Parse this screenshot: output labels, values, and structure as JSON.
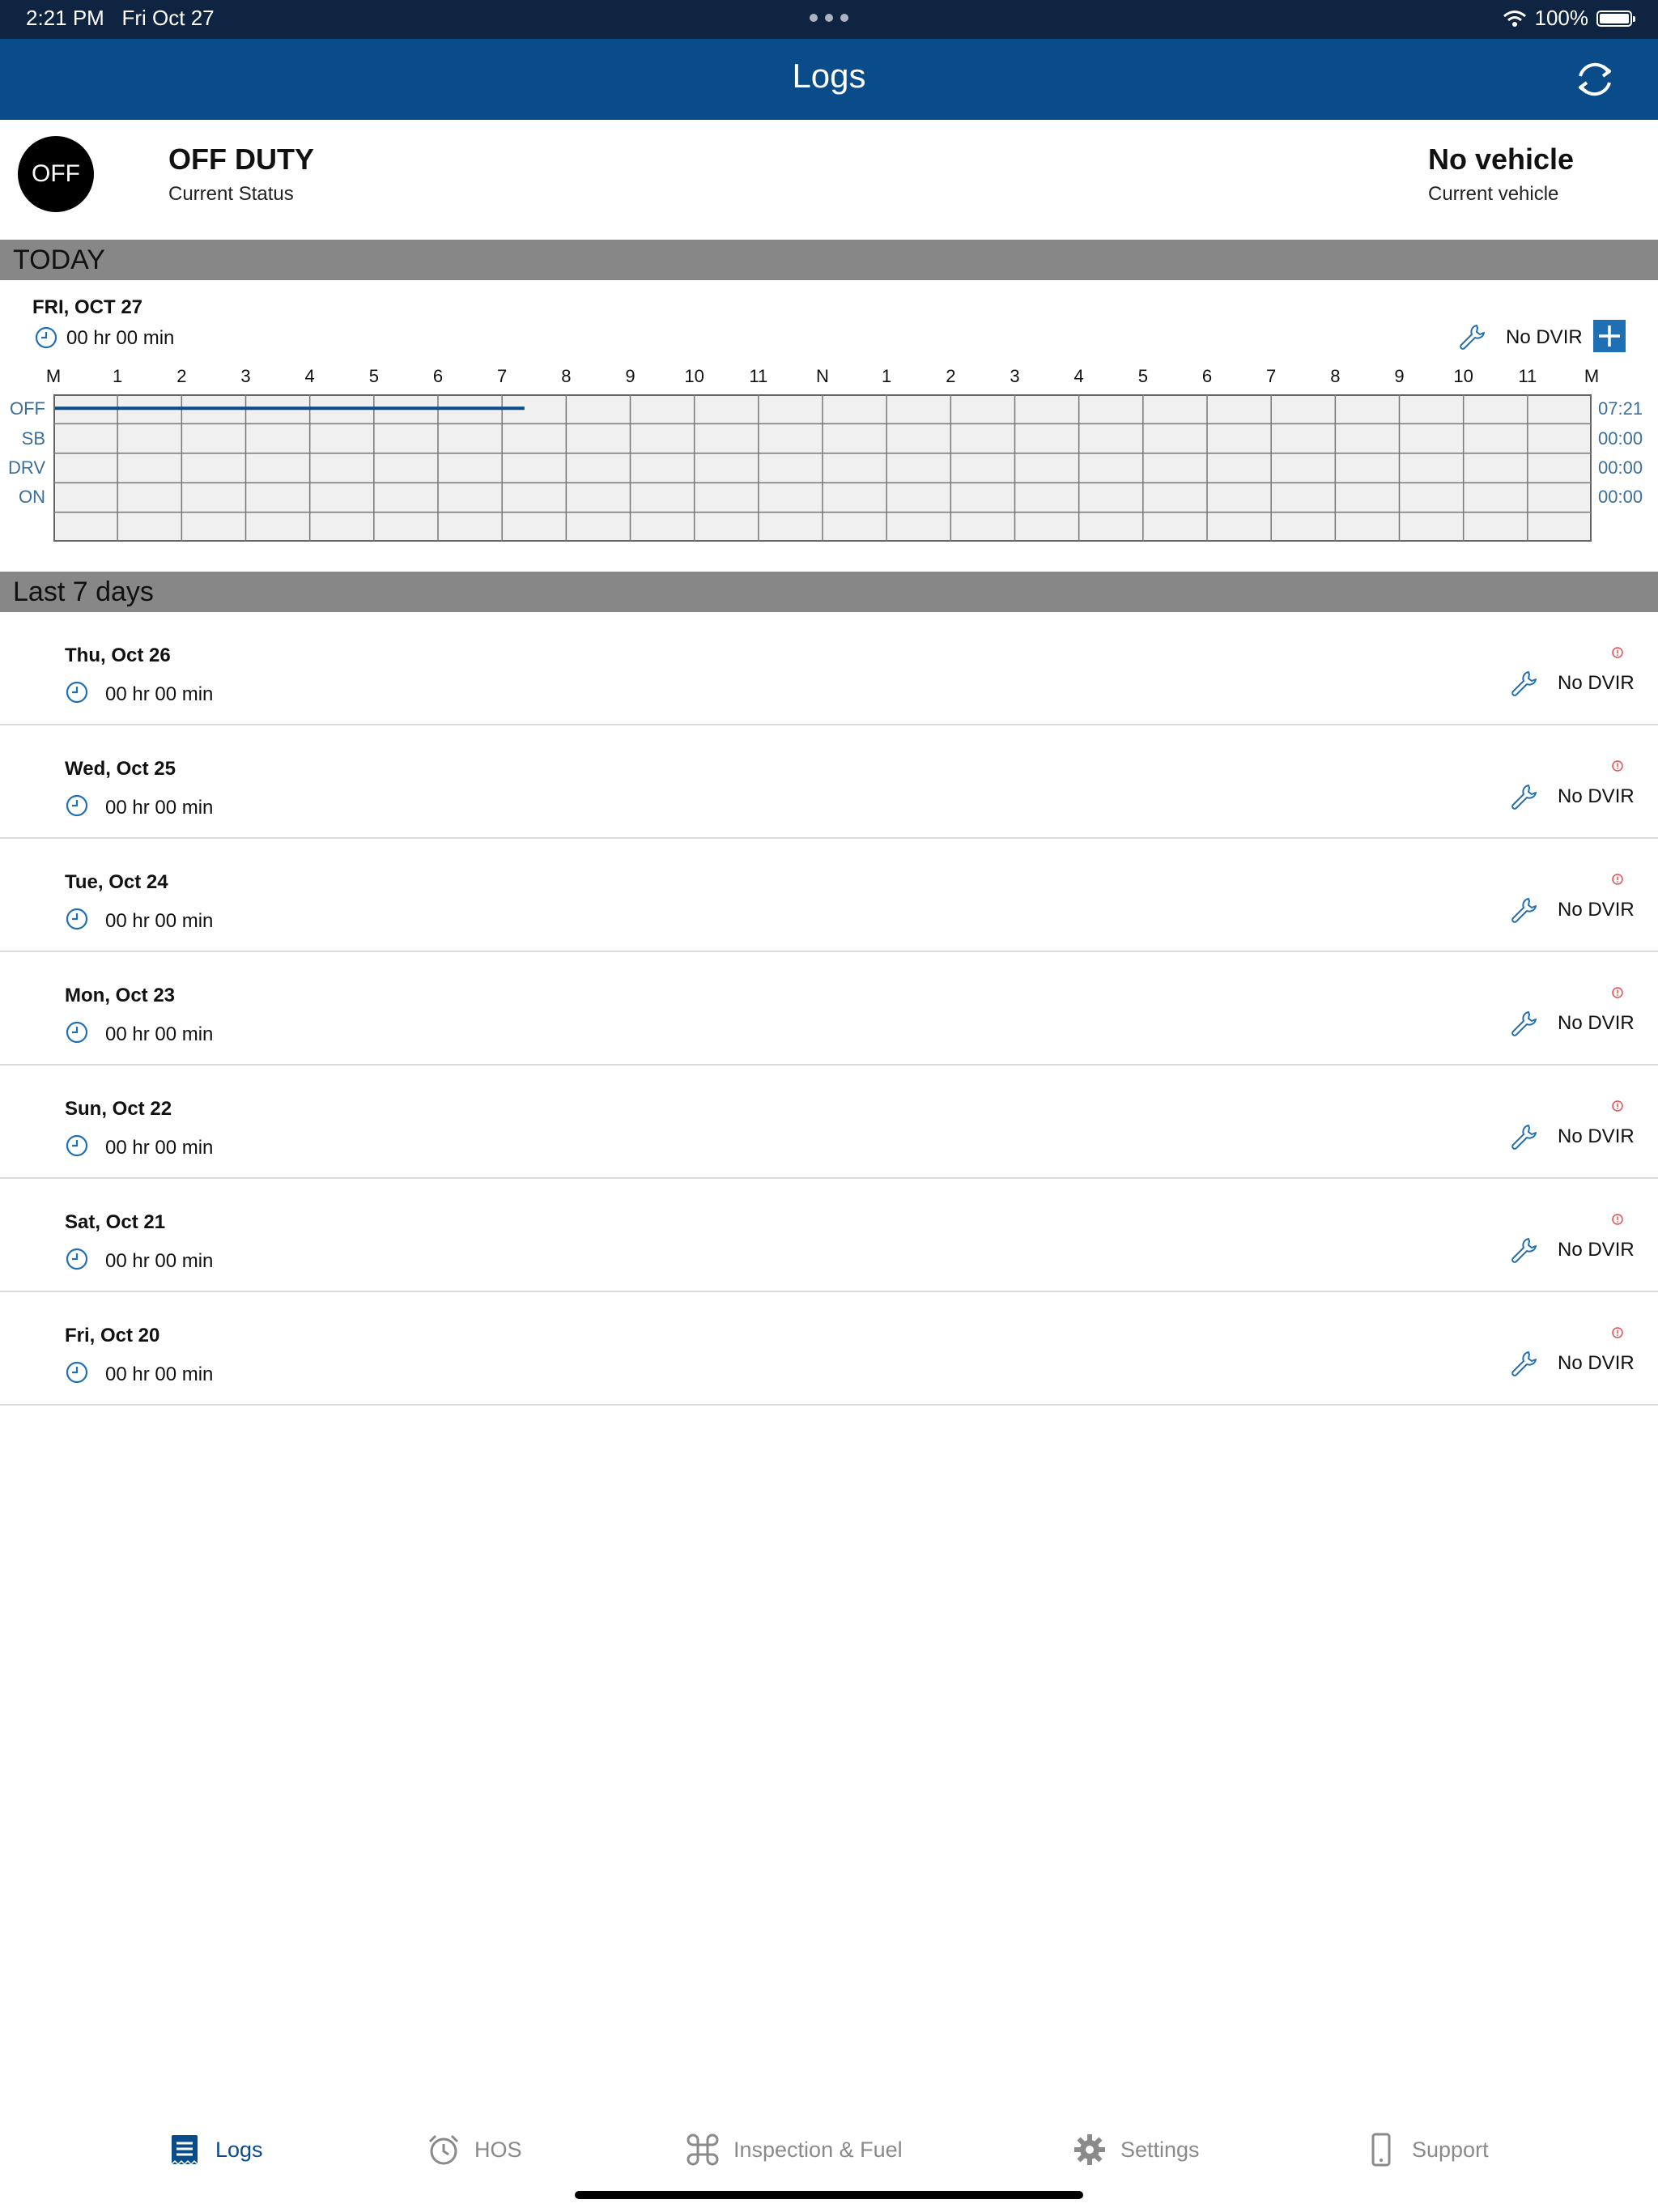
{
  "status_bar": {
    "time": "2:21 PM",
    "date": "Fri Oct 27",
    "battery": "100%"
  },
  "nav": {
    "title": "Logs"
  },
  "current": {
    "badge": "OFF",
    "status": "OFF DUTY",
    "status_label": "Current Status",
    "vehicle": "No vehicle",
    "vehicle_label": "Current vehicle"
  },
  "today": {
    "section_title": "TODAY",
    "date": "FRI, OCT 27",
    "duration": "00 hr 00 min",
    "dvir": "No DVIR",
    "hour_labels": [
      "M",
      "1",
      "2",
      "3",
      "4",
      "5",
      "6",
      "7",
      "8",
      "9",
      "10",
      "11",
      "N",
      "1",
      "2",
      "3",
      "4",
      "5",
      "6",
      "7",
      "8",
      "9",
      "10",
      "11",
      "M"
    ],
    "rows": [
      {
        "label": "OFF",
        "total": "07:21"
      },
      {
        "label": "SB",
        "total": "00:00"
      },
      {
        "label": "DRV",
        "total": "00:00"
      },
      {
        "label": "ON",
        "total": "00:00"
      }
    ],
    "off_duty_hours": 7.35,
    "line_color": "#0a4c8a"
  },
  "last7": {
    "section_title": "Last 7 days",
    "days": [
      {
        "date": "Thu, Oct 26",
        "duration": "00 hr 00 min",
        "dvir": "No DVIR"
      },
      {
        "date": "Wed, Oct 25",
        "duration": "00 hr 00 min",
        "dvir": "No DVIR"
      },
      {
        "date": "Tue, Oct 24",
        "duration": "00 hr 00 min",
        "dvir": "No DVIR"
      },
      {
        "date": "Mon, Oct 23",
        "duration": "00 hr 00 min",
        "dvir": "No DVIR"
      },
      {
        "date": "Sun, Oct 22",
        "duration": "00 hr 00 min",
        "dvir": "No DVIR"
      },
      {
        "date": "Sat, Oct 21",
        "duration": "00 hr 00 min",
        "dvir": "No DVIR"
      },
      {
        "date": "Fri, Oct 20",
        "duration": "00 hr 00 min",
        "dvir": "No DVIR"
      }
    ]
  },
  "tabs": [
    {
      "label": "Logs",
      "icon": "logs-icon",
      "active": true
    },
    {
      "label": "HOS",
      "icon": "alarm-clock-icon",
      "active": false
    },
    {
      "label": "Inspection & Fuel",
      "icon": "command-icon",
      "active": false
    },
    {
      "label": "Settings",
      "icon": "gear-icon",
      "active": false
    },
    {
      "label": "Support",
      "icon": "phone-icon",
      "active": false
    }
  ],
  "colors": {
    "nav": "#0a4c8a",
    "status_bar": "#0f2441",
    "section": "#878787",
    "accent": "#1f6fb5",
    "alert": "#e05050"
  }
}
